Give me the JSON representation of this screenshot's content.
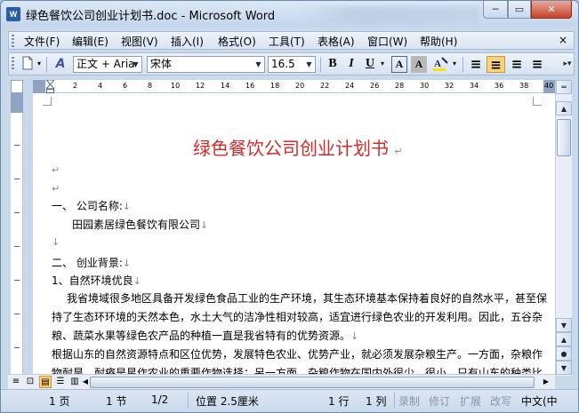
{
  "window": {
    "title": "绿色餐饮公司创业计划书.doc - Microsoft Word",
    "app_icon_text": "W",
    "minimize_glyph": "─",
    "maximize_glyph": "▭",
    "close_glyph": "✕"
  },
  "menu": {
    "items": [
      "文件(F)",
      "编辑(E)",
      "视图(V)",
      "插入(I)",
      "格式(O)",
      "工具(T)",
      "表格(A)",
      "窗口(W)",
      "帮助(H)"
    ],
    "doc_close": "×"
  },
  "toolbar": {
    "style_value": "正文 + Aria",
    "font_value": "宋体",
    "size_value": "16.5",
    "bold": "B",
    "italic": "I",
    "underline": "U",
    "char_border": "A",
    "char_shading": "A",
    "highlight_arrow": "▾",
    "align_left": "≡",
    "align_center": "≡",
    "align_right": "≡",
    "align_justify": "≡",
    "style_icon": "A",
    "selected_align": "center"
  },
  "ruler": {
    "numbers": [
      "2",
      "4",
      "6",
      "8",
      "10",
      "12",
      "14",
      "16",
      "18",
      "20",
      "22",
      "24",
      "26",
      "28",
      "30",
      "32",
      "34",
      "36",
      "38",
      "40"
    ]
  },
  "document": {
    "title": "绿色餐饮公司创业计划书",
    "title_color": "#d32a2a",
    "lines": [
      "一、 公司名称:",
      "田园素居绿色餐饮有限公司",
      "二、 创业背景:",
      "1、自然环境优良",
      "我省境域很多地区具备开发绿色食品工业的生产环境，其生态环境基本保持着良好的自然水平，甚至保",
      "持了生态环环境的天然本色，水土大气的洁净性相对较高，适宜进行绿色农业的开发利用。因此，五谷杂",
      "粮、蔬菜水果等绿色农产品的种植一直是我省特有的优势资源。",
      "根据山东的自然资源特点和区位优势，发展特色农业、优势产业，就必须发展杂粮生产。一方面，杂粮作",
      "物耐旱、耐瘠是星作农业的重要作物选择；另一方面，杂粮作物在国内外很少，很小，只有山东的种类比"
    ],
    "para_mark": "↵",
    "line_break_mark": "↓"
  },
  "statusbar": {
    "page": "1 页",
    "section": "1 节",
    "page_of": "1/2",
    "position": "位置 2.5厘米",
    "row": "1 行",
    "col": "1 列",
    "rec": "录制",
    "trk": "修订",
    "ext": "扩展",
    "ovr": "改写",
    "lang": "中文(中"
  },
  "colors": {
    "accent": "#fbd27a",
    "frame": "#c9d9ec"
  }
}
